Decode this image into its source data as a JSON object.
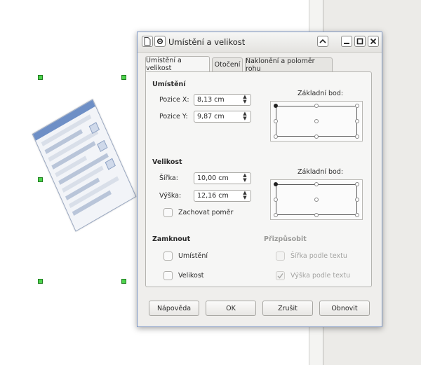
{
  "dialog": {
    "title": "Umístění a velikost",
    "tabs": [
      {
        "label": "Umístění a velikost",
        "active": true
      },
      {
        "label": "Otočení",
        "active": false
      },
      {
        "label": "Naklonění a poloměr rohu",
        "active": false
      }
    ],
    "position": {
      "section_label": "Umístění",
      "x_label": "Pozice X:",
      "x_value": "8,13 cm",
      "y_label": "Pozice Y:",
      "y_value": "9,87 cm",
      "base_point_label": "Základní bod:"
    },
    "size": {
      "section_label": "Velikost",
      "width_label": "Šířka:",
      "width_value": "10,00 cm",
      "height_label": "Výška:",
      "height_value": "12,16 cm",
      "keep_ratio_label": "Zachovat poměr",
      "keep_ratio_checked": false,
      "base_point_label": "Základní bod:"
    },
    "protect": {
      "section_label": "Zamknout",
      "position_label": "Umístění",
      "position_checked": false,
      "size_label": "Velikost",
      "size_checked": false
    },
    "adapt": {
      "section_label": "Přizpůsobit",
      "fit_width_label": "Šířka podle textu",
      "fit_width_checked": false,
      "fit_height_label": "Výška podle textu",
      "fit_height_checked": true,
      "enabled": false
    },
    "buttons": {
      "help": "Nápověda",
      "ok": "OK",
      "cancel": "Zrušit",
      "reset": "Obnovit"
    },
    "titlebar_icons": [
      "document-icon",
      "pin-icon",
      "shade-up-icon",
      "minimize-icon",
      "maximize-icon",
      "close-icon"
    ]
  },
  "colors": {
    "selection_handle": "#4cd34c",
    "dialog_border": "#7e97c4",
    "dialog_bg": "#efeeec"
  }
}
